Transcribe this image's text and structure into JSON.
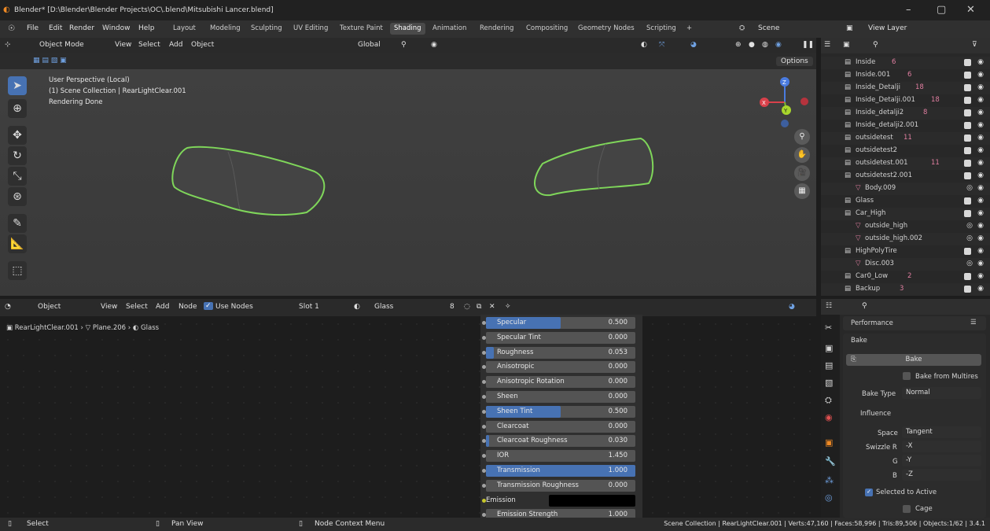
{
  "window": {
    "title": "Blender* [D:\\Blender\\Blender Projects\\OC\\.blend\\Mitsubishi Lancer.blend]",
    "minimize": "–",
    "maximize": "▢",
    "close": "✕"
  },
  "menu": {
    "items": [
      "File",
      "Edit",
      "Render",
      "Window",
      "Help"
    ]
  },
  "workspaces": [
    "Layout",
    "Modeling",
    "Sculpting",
    "UV Editing",
    "Texture Paint",
    "Shading",
    "Animation",
    "Rendering",
    "Compositing",
    "Geometry Nodes",
    "Scripting",
    "+"
  ],
  "active_workspace": "Shading",
  "scene": {
    "label": "Scene",
    "view_layer": "View Layer"
  },
  "viewport_header": {
    "mode": "Object Mode",
    "view": "View",
    "select": "Select",
    "add": "Add",
    "object": "Object",
    "transform": "Global",
    "options": "Options"
  },
  "viewport_overlay": {
    "line1": "User Perspective (Local)",
    "line2": "(1) Scene Collection | RearLightClear.001",
    "line3": "Rendering Done"
  },
  "gizmo": {
    "z": "Z",
    "y": "Y",
    "x": "X"
  },
  "outliner": {
    "search_placeholder": "",
    "rows": [
      {
        "name": "Inside",
        "badge": "6"
      },
      {
        "name": "Inside.001",
        "badge": "6"
      },
      {
        "name": "Inside_Detalji",
        "badge": "18"
      },
      {
        "name": "Inside_Detalji.001",
        "badge": "18"
      },
      {
        "name": "Inside_detalji2",
        "badge": "8"
      },
      {
        "name": "Inside_detalji2.001",
        "badge": ""
      },
      {
        "name": "outsidetest",
        "badge": "11"
      },
      {
        "name": "outsidetest2",
        "badge": ""
      },
      {
        "name": "outsidetest.001",
        "badge": "11"
      },
      {
        "name": "outsidetest2.001",
        "badge": ""
      },
      {
        "name": "Body.009",
        "badge": ""
      },
      {
        "name": "Glass",
        "badge": ""
      },
      {
        "name": "Car_High",
        "badge": ""
      },
      {
        "name": "outside_high",
        "badge": ""
      },
      {
        "name": "outside_high.002",
        "badge": ""
      },
      {
        "name": "HighPolyTire",
        "badge": ""
      },
      {
        "name": "Disc.003",
        "badge": ""
      },
      {
        "name": "Car0_Low",
        "badge": "2"
      },
      {
        "name": "Backup",
        "badge": "3"
      }
    ]
  },
  "node_header": {
    "editor": "Object",
    "view": "View",
    "select": "Select",
    "add": "Add",
    "node": "Node",
    "use_nodes": "Use Nodes",
    "slot": "Slot 1",
    "material": "Glass",
    "users": "8"
  },
  "breadcrumb": {
    "object": "RearLightClear.001",
    "mesh": "Plane.206",
    "material": "Glass"
  },
  "node_inputs": [
    {
      "label": "Specular",
      "value": "0.500",
      "fill": 0.5
    },
    {
      "label": "Specular Tint",
      "value": "0.000",
      "fill": 0
    },
    {
      "label": "Roughness",
      "value": "0.053",
      "fill": 0.053
    },
    {
      "label": "Anisotropic",
      "value": "0.000",
      "fill": 0
    },
    {
      "label": "Anisotropic Rotation",
      "value": "0.000",
      "fill": 0
    },
    {
      "label": "Sheen",
      "value": "0.000",
      "fill": 0
    },
    {
      "label": "Sheen Tint",
      "value": "0.500",
      "fill": 0.5
    },
    {
      "label": "Clearcoat",
      "value": "0.000",
      "fill": 0
    },
    {
      "label": "Clearcoat Roughness",
      "value": "0.030",
      "fill": 0.03
    },
    {
      "label": "IOR",
      "value": "1.450",
      "fill": 0
    },
    {
      "label": "Transmission",
      "value": "1.000",
      "fill": 1
    },
    {
      "label": "Transmission Roughness",
      "value": "0.000",
      "fill": 0
    },
    {
      "label": "Emission",
      "value": "",
      "fill": 0
    },
    {
      "label": "Emission Strength",
      "value": "1.000",
      "fill": 0
    }
  ],
  "properties": {
    "performance": "Performance",
    "bake": "Bake",
    "bake_button": "Bake",
    "bake_from_multires": "Bake from Multires",
    "bake_type_label": "Bake Type",
    "bake_type": "Normal",
    "influence": "Influence",
    "space_label": "Space",
    "space": "Tangent",
    "swizzle_r_label": "Swizzle R",
    "swizzle_r": "-X",
    "g_label": "G",
    "g": "-Y",
    "b_label": "B",
    "b": "-Z",
    "selected_to_active": "Selected to Active",
    "cage": "Cage"
  },
  "statusbar": {
    "select": "Select",
    "pan": "Pan View",
    "context": "Node Context Menu",
    "stats": "Scene Collection | RearLightClear.001 | Verts:47,160 | Faces:58,996 | Tris:89,506 | Objects:1/62 | 3.4.1"
  },
  "colors": {
    "accent": "#4772b3",
    "outline": "#7fd65a",
    "bg": "#1d1d1d"
  }
}
